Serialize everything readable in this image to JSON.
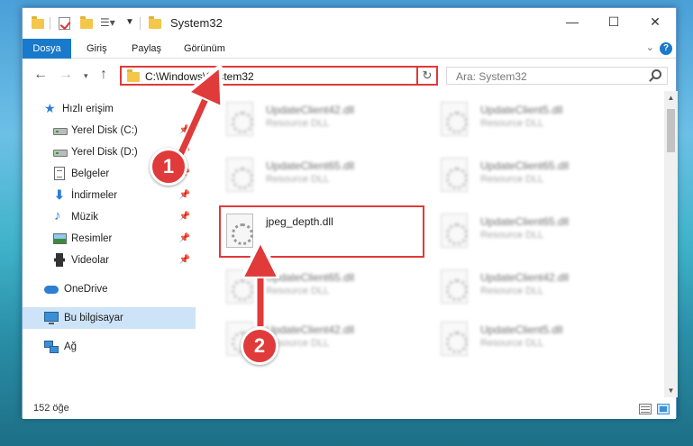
{
  "window": {
    "title": "System32"
  },
  "ribbon": {
    "tabs": [
      "Dosya",
      "Giriş",
      "Paylaş",
      "Görünüm"
    ]
  },
  "nav": {
    "address": "C:\\Windows\\System32",
    "search_placeholder": "Ara: System32"
  },
  "sidebar": {
    "items": [
      {
        "label": "Hızlı erişim",
        "icon": "star-icon",
        "pinned": false
      },
      {
        "label": "Yerel Disk (C:)",
        "icon": "drive-icon",
        "pinned": true
      },
      {
        "label": "Yerel Disk (D:)",
        "icon": "drive-icon",
        "pinned": true
      },
      {
        "label": "Belgeler",
        "icon": "document-icon",
        "pinned": true
      },
      {
        "label": "İndirmeler",
        "icon": "download-icon",
        "pinned": true
      },
      {
        "label": "Müzik",
        "icon": "music-icon",
        "pinned": true
      },
      {
        "label": "Resimler",
        "icon": "pictures-icon",
        "pinned": true
      },
      {
        "label": "Videolar",
        "icon": "video-icon",
        "pinned": true
      },
      {
        "label": "OneDrive",
        "icon": "cloud-icon",
        "pinned": false
      },
      {
        "label": "Bu bilgisayar",
        "icon": "computer-icon",
        "pinned": false
      },
      {
        "label": "Ağ",
        "icon": "network-icon",
        "pinned": false
      }
    ]
  },
  "files": [
    {
      "name": "UpdateClient42.dll",
      "type": "Resource DLL"
    },
    {
      "name": "UpdateClient5.dll",
      "type": "Resource DLL"
    },
    {
      "name": "UpdateClient65.dll",
      "type": "Resource DLL"
    },
    {
      "name": "UpdateClient65.dll",
      "type": "Resource DLL"
    },
    {
      "name": "jpeg_depth.dll",
      "type": ""
    },
    {
      "name": "UpdateClient65.dll",
      "type": "Resource DLL"
    },
    {
      "name": "UpdateClient65.dll",
      "type": "Resource DLL"
    },
    {
      "name": "UpdateClient42.dll",
      "type": "Resource DLL"
    },
    {
      "name": "UpdateClient42.dll",
      "type": "Resource DLL"
    },
    {
      "name": "UpdateClient5.dll",
      "type": "Resource DLL"
    }
  ],
  "status": {
    "count": "152 öğe"
  },
  "annotations": {
    "step1": "1",
    "step2": "2"
  },
  "colors": {
    "accent": "#1979ca",
    "highlight": "#e03a3a",
    "selected": "#cde3f7"
  }
}
